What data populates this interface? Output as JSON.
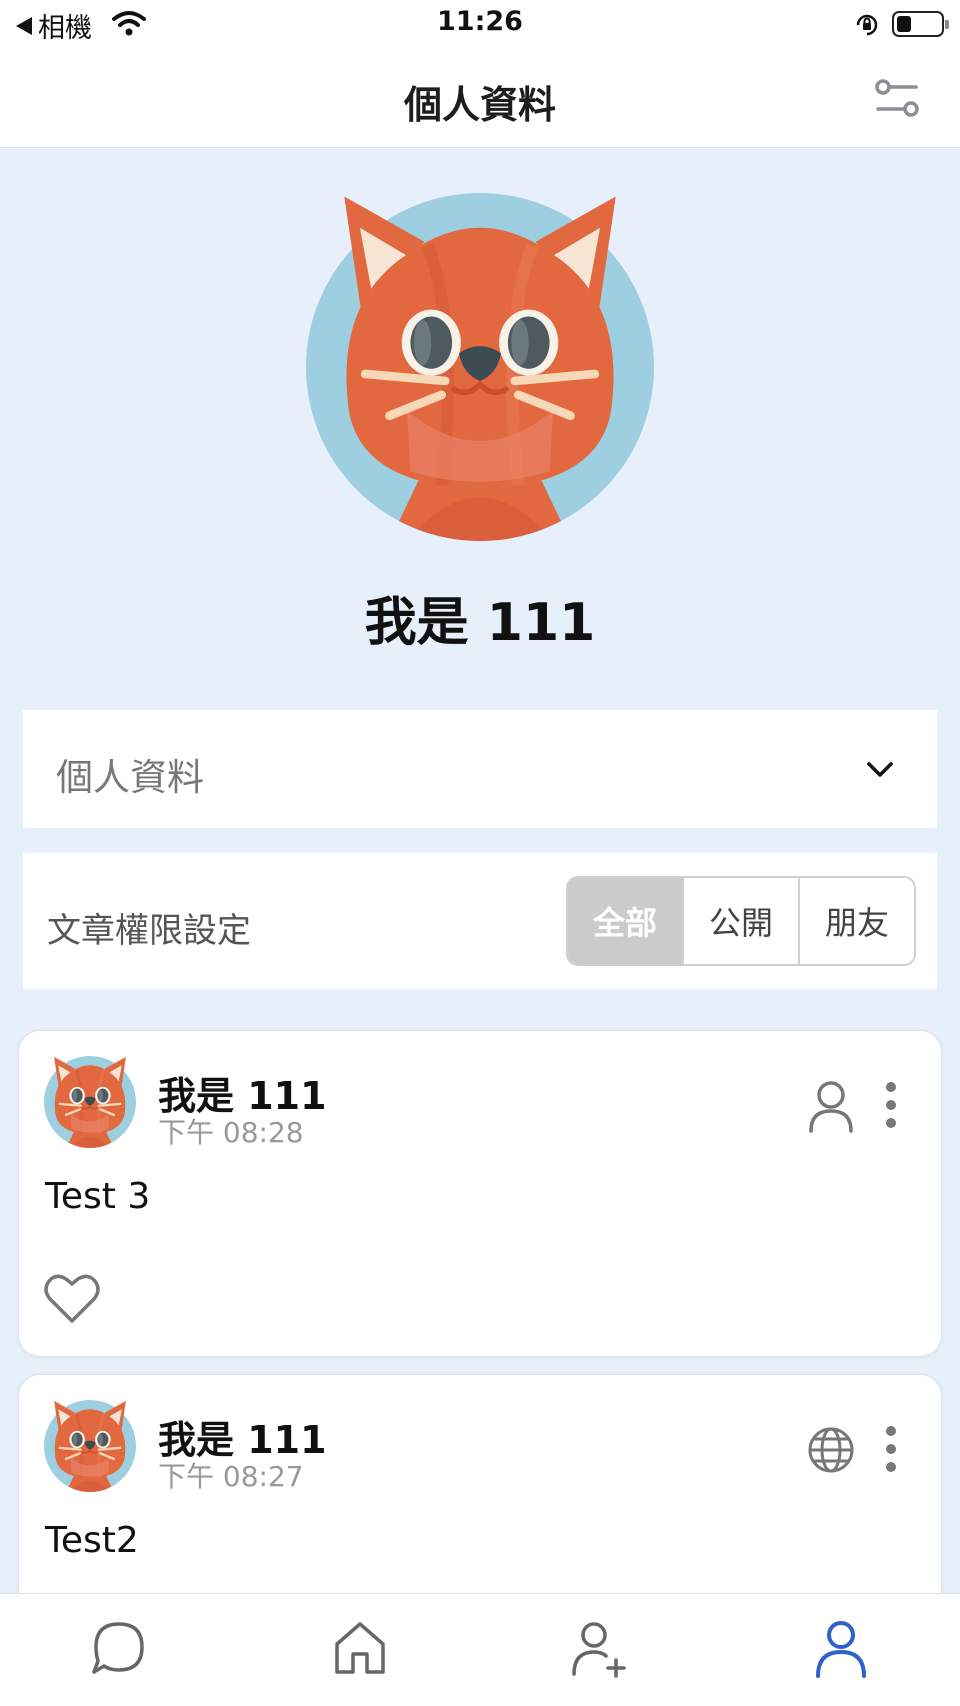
{
  "status_bar": {
    "back_app": "相機",
    "time": "11:26"
  },
  "header": {
    "title": "個人資料",
    "filter_icon": "sliders-icon"
  },
  "profile": {
    "avatar_icon": "cat-avatar",
    "name": "我是 111"
  },
  "info_section": {
    "label": "個人資料",
    "icon": "chevron-down-icon"
  },
  "permission": {
    "label": "文章權限設定",
    "options": [
      "全部",
      "公開",
      "朋友"
    ],
    "selected": "全部"
  },
  "posts": [
    {
      "author": "我是 111",
      "time": "下午 08:28",
      "content": "Test 3",
      "visibility_icon": "person-icon"
    },
    {
      "author": "我是 111",
      "time": "下午 08:27",
      "content": "Test2",
      "visibility_icon": "globe-icon"
    }
  ],
  "tab_bar": {
    "tabs": [
      "chat-icon",
      "home-icon",
      "add-friend-icon",
      "profile-icon"
    ],
    "active": "profile-icon"
  },
  "colors": {
    "page_background": "#e7f0fa",
    "active_tab": "#2f62c8",
    "segment_active": "#cbcbcb",
    "cat_orange": "#e2683f",
    "avatar_circle": "#9ecfe1"
  }
}
